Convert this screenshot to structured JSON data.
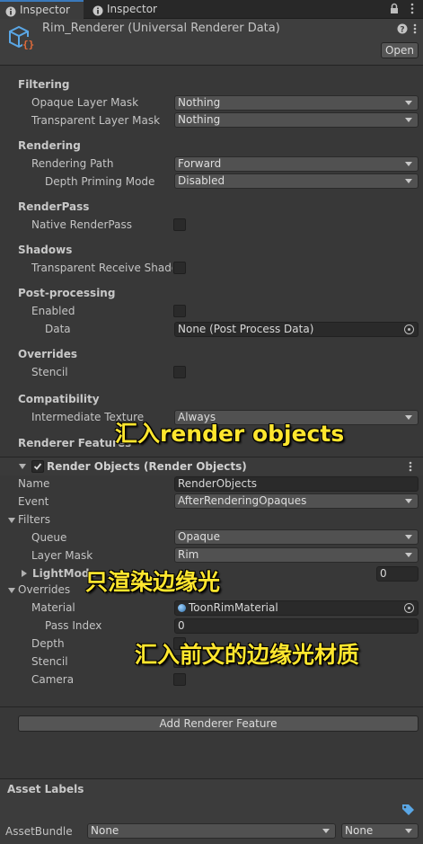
{
  "tabs": [
    {
      "label": "Inspector"
    },
    {
      "label": "Inspector"
    }
  ],
  "header": {
    "title": "Rim_Renderer (Universal Renderer Data)",
    "open_label": "Open"
  },
  "filtering": {
    "section": "Filtering",
    "opaque_label": "Opaque Layer Mask",
    "opaque_value": "Nothing",
    "transparent_label": "Transparent Layer Mask",
    "transparent_value": "Nothing"
  },
  "rendering": {
    "section": "Rendering",
    "path_label": "Rendering Path",
    "path_value": "Forward",
    "depth_label": "Depth Priming Mode",
    "depth_value": "Disabled"
  },
  "renderpass": {
    "section": "RenderPass",
    "native_label": "Native RenderPass"
  },
  "shadows": {
    "section": "Shadows",
    "transparent_label": "Transparent Receive Shado"
  },
  "postprocessing": {
    "section": "Post-processing",
    "enabled_label": "Enabled",
    "data_label": "Data",
    "data_value": "None (Post Process Data)"
  },
  "overrides": {
    "section": "Overrides",
    "stencil_label": "Stencil"
  },
  "compatibility": {
    "section": "Compatibility",
    "intermediate_label": "Intermediate Texture",
    "intermediate_value": "Always"
  },
  "renderer_features": {
    "section": "Renderer Features",
    "feature_title": "Render Objects (Render Objects)",
    "name_label": "Name",
    "name_value": "RenderObjects",
    "event_label": "Event",
    "event_value": "AfterRenderingOpaques",
    "filters_label": "Filters",
    "queue_label": "Queue",
    "queue_value": "Opaque",
    "layermask_label": "Layer Mask",
    "layermask_value": "Rim",
    "lightmode_label": "LightMode",
    "lightmode_value": "0",
    "overrides_label": "Overrides",
    "material_label": "Material",
    "material_value": "ToonRimMaterial",
    "passindex_label": "Pass Index",
    "passindex_value": "0",
    "depth_label": "Depth",
    "stencil_label": "Stencil",
    "camera_label": "Camera",
    "add_button": "Add Renderer Feature"
  },
  "asset_labels": {
    "section": "Asset Labels",
    "bundle_label": "AssetBundle",
    "bundle_value": "None",
    "variant_value": "None"
  },
  "annotations": {
    "import_render_objects": "汇入render objects",
    "render_rim_only": "只渲染边缘光",
    "import_rim_material": "汇入前文的边缘光材质"
  },
  "colors": {
    "accent": "#3a79bb",
    "annotation": "#ffe62e",
    "background": "#383838"
  }
}
